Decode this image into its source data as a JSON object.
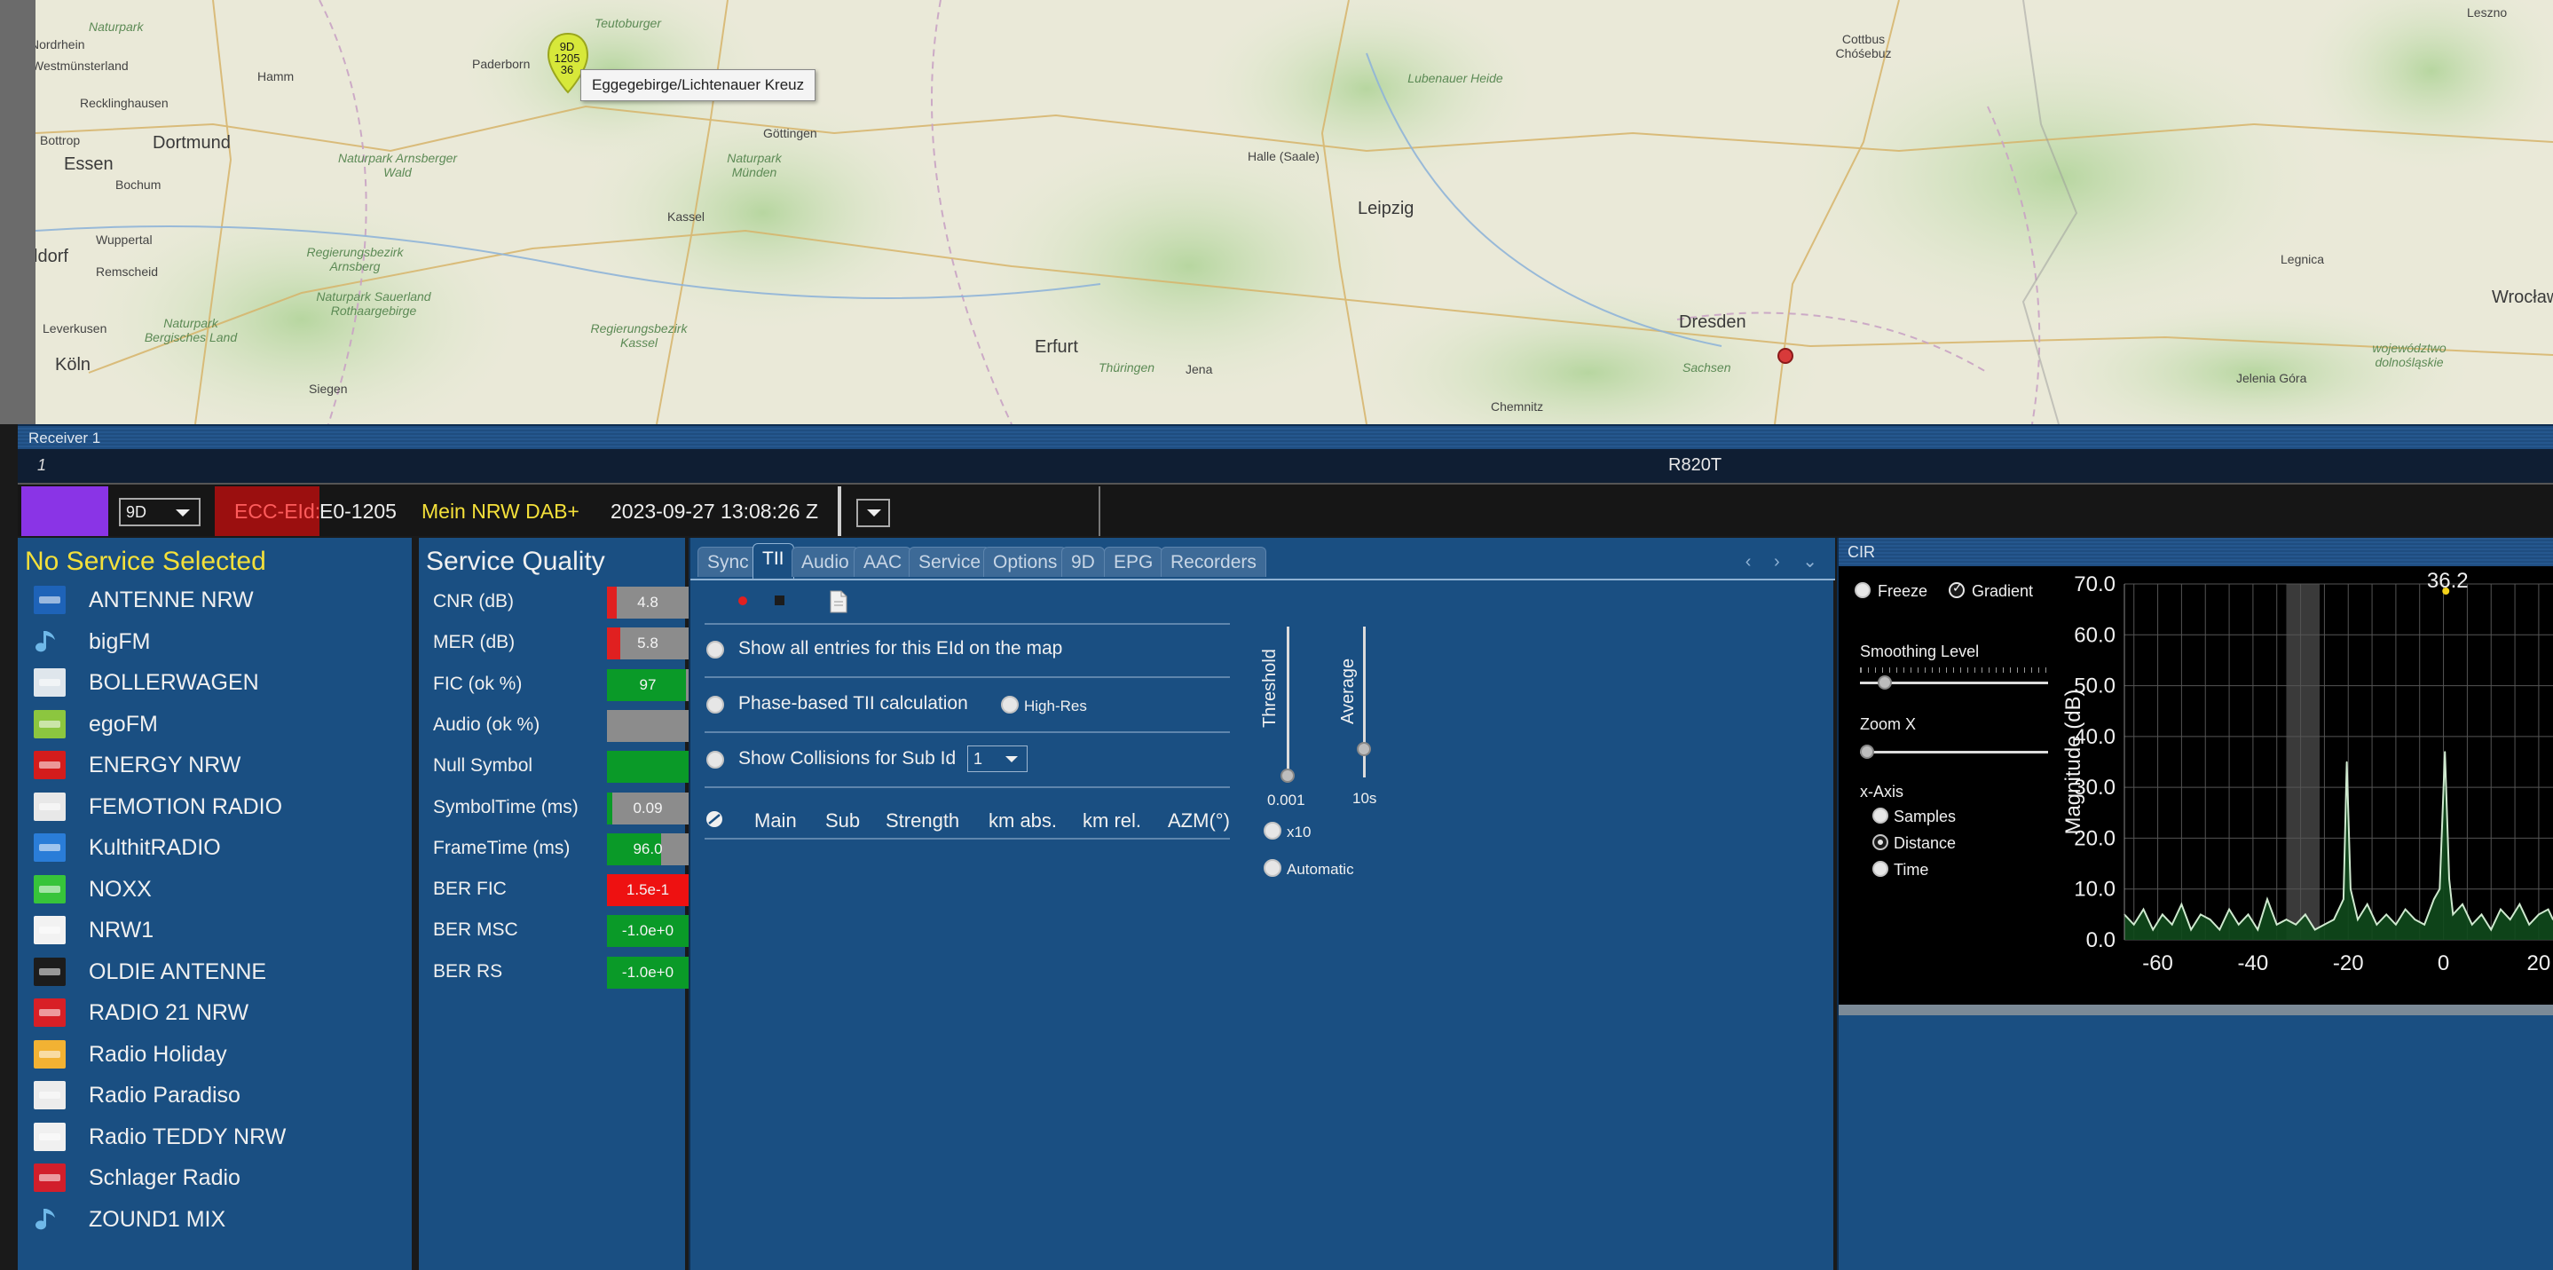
{
  "map": {
    "tooltip": "Eggegebirge/Lichtenauer Kreuz",
    "marker_lines": [
      "9D",
      "1205",
      "36"
    ],
    "labels": [
      {
        "text": "Naturpark",
        "cls": "map-region",
        "name": "map-label-naturpark-1"
      },
      {
        "text": "Nordrhein",
        "cls": "map-town",
        "name": "map-label-nordrhein"
      },
      {
        "text": "Westmünsterland",
        "cls": "map-town",
        "name": "map-label-westmunsterland"
      },
      {
        "text": "Hamm",
        "cls": "map-town",
        "name": "map-label-hamm"
      },
      {
        "text": "Recklinghausen",
        "cls": "map-town",
        "name": "map-label-recklinghausen"
      },
      {
        "text": "Bottrop",
        "cls": "map-town",
        "name": "map-label-bottrop"
      },
      {
        "text": "Dortmund",
        "cls": "map-city",
        "name": "map-label-dortmund"
      },
      {
        "text": "Essen",
        "cls": "map-city",
        "name": "map-label-essen"
      },
      {
        "text": "Bochum",
        "cls": "map-town",
        "name": "map-label-bochum"
      },
      {
        "text": "Wuppertal",
        "cls": "map-town",
        "name": "map-label-wuppertal"
      },
      {
        "text": "Remscheid",
        "cls": "map-town",
        "name": "map-label-remscheid"
      },
      {
        "text": "ldorf",
        "cls": "map-city",
        "name": "map-label-dusseldorf"
      },
      {
        "text": "Leverkusen",
        "cls": "map-town",
        "name": "map-label-leverkusen"
      },
      {
        "text": "Köln",
        "cls": "map-city",
        "name": "map-label-koln"
      },
      {
        "text": "Siegen",
        "cls": "map-town",
        "name": "map-label-siegen"
      },
      {
        "text": "Paderborn",
        "cls": "map-town",
        "name": "map-label-paderborn"
      },
      {
        "text": "Teutoburger",
        "cls": "map-region",
        "name": "map-label-teutoburger"
      },
      {
        "text": "Göttingen",
        "cls": "map-town",
        "name": "map-label-gottingen"
      },
      {
        "text": "Kassel",
        "cls": "map-town",
        "name": "map-label-kassel"
      },
      {
        "text": "Naturpark Arnsberger Wald",
        "cls": "map-region",
        "name": "map-label-arnsberger"
      },
      {
        "text": "Regierungsbezirk Arnsberg",
        "cls": "map-region",
        "name": "map-label-rb-arnsberg"
      },
      {
        "text": "Naturpark Sauerland Rothaargebirge",
        "cls": "map-region",
        "name": "map-label-sauerland"
      },
      {
        "text": "Naturpark Bergisches Land",
        "cls": "map-region",
        "name": "map-label-bergisches"
      },
      {
        "text": "Regierungsbezirk Kassel",
        "cls": "map-region",
        "name": "map-label-rb-kassel"
      },
      {
        "text": "Naturpark Münden",
        "cls": "map-region",
        "name": "map-label-munden"
      },
      {
        "text": "Halle (Saale)",
        "cls": "map-town",
        "name": "map-label-halle"
      },
      {
        "text": "Leipzig",
        "cls": "map-city",
        "name": "map-label-leipzig"
      },
      {
        "text": "Erfurt",
        "cls": "map-city",
        "name": "map-label-erfurt"
      },
      {
        "text": "Jena",
        "cls": "map-town",
        "name": "map-label-jena"
      },
      {
        "text": "Thüringen",
        "cls": "map-region",
        "name": "map-label-thuringen"
      },
      {
        "text": "Dresden",
        "cls": "map-city",
        "name": "map-label-dresden"
      },
      {
        "text": "Sachsen",
        "cls": "map-region",
        "name": "map-label-sachsen"
      },
      {
        "text": "Chemnitz",
        "cls": "map-town",
        "name": "map-label-chemnitz"
      },
      {
        "text": "Cottbus Chóśebuz",
        "cls": "map-town",
        "name": "map-label-cottbus"
      },
      {
        "text": "Lubenauer Heide",
        "cls": "map-region",
        "name": "map-label-lubenauer"
      },
      {
        "text": "Legnica",
        "cls": "map-town",
        "name": "map-label-legnica"
      },
      {
        "text": "Wrocław",
        "cls": "map-city",
        "name": "map-label-wroclaw"
      },
      {
        "text": "Jelenia Góra",
        "cls": "map-town",
        "name": "map-label-jelenia"
      },
      {
        "text": "województwo dolnośląskie",
        "cls": "map-region",
        "name": "map-label-dolnoslaskie"
      },
      {
        "text": "Leszno",
        "cls": "map-town",
        "name": "map-label-leszno"
      }
    ]
  },
  "receiver": {
    "title": "Receiver 1",
    "device_index": "1",
    "device_name": "R820T"
  },
  "ensemble": {
    "channel": "9D",
    "ecc_label": "ECC-EId:",
    "ecc_value": "E0-1205",
    "name": "Mein NRW DAB+",
    "datetime": "2023-09-27  13:08:26 Z"
  },
  "services": {
    "header": "No Service Selected",
    "items": [
      {
        "label": "ANTENNE NRW",
        "logo": "#1e63b8",
        "logo_icon": "radio-logo-icon"
      },
      {
        "label": "bigFM",
        "logo": "note",
        "logo_icon": "music-note-icon"
      },
      {
        "label": "BOLLERWAGEN",
        "logo": "#dfe6ec",
        "logo_icon": "radio-logo-icon"
      },
      {
        "label": "egoFM",
        "logo": "#8cc63f",
        "logo_icon": "radio-logo-icon"
      },
      {
        "label": "ENERGY NRW",
        "logo": "#d41c1c",
        "logo_icon": "radio-logo-icon"
      },
      {
        "label": "FEMOTION RADIO",
        "logo": "#e8e8e8",
        "logo_icon": "radio-logo-icon"
      },
      {
        "label": "KulthitRADIO",
        "logo": "#2a7dd8",
        "logo_icon": "radio-logo-icon"
      },
      {
        "label": "NOXX",
        "logo": "#37c43a",
        "logo_icon": "radio-logo-icon"
      },
      {
        "label": "NRW1",
        "logo": "#f2f2f2",
        "logo_icon": "radio-logo-icon"
      },
      {
        "label": "OLDIE ANTENNE",
        "logo": "#1c1c1c",
        "logo_icon": "radio-logo-icon"
      },
      {
        "label": "RADIO 21 NRW",
        "logo": "#d81f26",
        "logo_icon": "radio-logo-icon"
      },
      {
        "label": "Radio Holiday",
        "logo": "#f2b233",
        "logo_icon": "radio-logo-icon"
      },
      {
        "label": "Radio Paradiso",
        "logo": "#ececec",
        "logo_icon": "radio-logo-icon"
      },
      {
        "label": "Radio TEDDY NRW",
        "logo": "#f0f0f0",
        "logo_icon": "radio-logo-icon"
      },
      {
        "label": "Schlager Radio",
        "logo": "#d21e2b",
        "logo_icon": "radio-logo-icon"
      },
      {
        "label": "ZOUND1 MIX",
        "logo": "note",
        "logo_icon": "music-note-icon"
      }
    ]
  },
  "quality": {
    "header": "Service Quality",
    "rows": [
      {
        "label": "CNR (dB)",
        "value": "4.8",
        "fill": 0.12,
        "color": "#e02020"
      },
      {
        "label": "MER (dB)",
        "value": "5.8",
        "fill": 0.16,
        "color": "#e02020"
      },
      {
        "label": "FIC (ok %)",
        "value": "97",
        "fill": 0.97,
        "color": "#0a9a28"
      },
      {
        "label": "Audio (ok %)",
        "value": "",
        "fill": 0,
        "color": "#0a9a28"
      },
      {
        "label": "Null Symbol",
        "value": "",
        "fill": 1,
        "color": "#0a9a28"
      },
      {
        "label": "SymbolTime (ms)",
        "value": "0.09",
        "fill": 0.06,
        "color": "#0a9a28"
      },
      {
        "label": "FrameTime (ms)",
        "value": "96.0",
        "fill": 0.66,
        "color": "#0a9a28"
      },
      {
        "label": "BER FIC",
        "value": "1.5e-1",
        "fill": 1,
        "color": "#ee1111"
      },
      {
        "label": "BER MSC",
        "value": "-1.0e+0",
        "fill": 1,
        "color": "#0a9a28"
      },
      {
        "label": "BER RS",
        "value": "-1.0e+0",
        "fill": 1,
        "color": "#0a9a28"
      }
    ]
  },
  "tii": {
    "tabs": [
      "Sync",
      "TII",
      "Audio",
      "AAC",
      "Service",
      "Options",
      "9D",
      "EPG",
      "Recorders"
    ],
    "active_tab": 1,
    "nav": "‹ › ⌄",
    "opt_show_all": "Show all entries for this EId on the map",
    "opt_phase": "Phase-based TII calculation",
    "opt_highres": "High-Res",
    "opt_collisions": "Show Collisions for Sub Id",
    "sub_id": "1",
    "columns": [
      "Main",
      "Sub",
      "Strength",
      "km abs.",
      "km rel.",
      "AZM(°)"
    ],
    "threshold_label": "Threshold",
    "threshold_value": "0.001",
    "threshold_level": 0.0,
    "average_label": "Average",
    "average_value": "10s",
    "average_level": 0.1,
    "x10_label": "x10",
    "automatic_label": "Automatic"
  },
  "cir": {
    "title": "CIR",
    "freeze": "Freeze",
    "gradient": "Gradient",
    "smoothing": "Smoothing Level",
    "zoom": "Zoom X",
    "xaxis": "x-Axis",
    "xaxis_options": [
      "Samples",
      "Distance",
      "Time"
    ],
    "xaxis_selected": 1,
    "peak_label": "36.2",
    "ylabel": "Magnitude (dB)"
  },
  "chart_data": {
    "type": "line",
    "ylabel": "Magnitude (dB)",
    "xlabel": "",
    "ylim": [
      0,
      70
    ],
    "xlim": [
      -67,
      23
    ],
    "yticks": [
      0.0,
      10.0,
      20.0,
      30.0,
      40.0,
      50.0,
      60.0,
      70.0
    ],
    "xticks": [
      -60,
      -40,
      -20,
      0,
      20
    ],
    "grid": true,
    "highlight_band": [
      -33,
      -26
    ],
    "peak_marker": {
      "x": 0.5,
      "label": "36.2"
    },
    "series": [
      {
        "values": [
          [
            -67,
            5
          ],
          [
            -65,
            3
          ],
          [
            -63,
            6
          ],
          [
            -61,
            2
          ],
          [
            -59,
            5
          ],
          [
            -57,
            3
          ],
          [
            -55,
            7
          ],
          [
            -53,
            2
          ],
          [
            -51,
            5
          ],
          [
            -49,
            4
          ],
          [
            -47,
            2
          ],
          [
            -45,
            6
          ],
          [
            -43,
            3
          ],
          [
            -41,
            5
          ],
          [
            -39,
            2
          ],
          [
            -37,
            8
          ],
          [
            -35,
            3
          ],
          [
            -33,
            4
          ],
          [
            -31,
            3
          ],
          [
            -29,
            5
          ],
          [
            -27,
            2
          ],
          [
            -25,
            3
          ],
          [
            -23,
            4
          ],
          [
            -21,
            8
          ],
          [
            -20.3,
            35
          ],
          [
            -19.5,
            10
          ],
          [
            -18,
            4
          ],
          [
            -16,
            7
          ],
          [
            -14,
            3
          ],
          [
            -12,
            5
          ],
          [
            -10,
            3
          ],
          [
            -8,
            6
          ],
          [
            -6,
            4
          ],
          [
            -4,
            3
          ],
          [
            -2,
            8
          ],
          [
            -0.8,
            10
          ],
          [
            0.3,
            37
          ],
          [
            1.2,
            12
          ],
          [
            2,
            5
          ],
          [
            4,
            7
          ],
          [
            6,
            3
          ],
          [
            8,
            5
          ],
          [
            10,
            2
          ],
          [
            12,
            6
          ],
          [
            14,
            4
          ],
          [
            16,
            7
          ],
          [
            18,
            3
          ],
          [
            20,
            5
          ],
          [
            22,
            6
          ],
          [
            23,
            4
          ]
        ]
      }
    ]
  }
}
